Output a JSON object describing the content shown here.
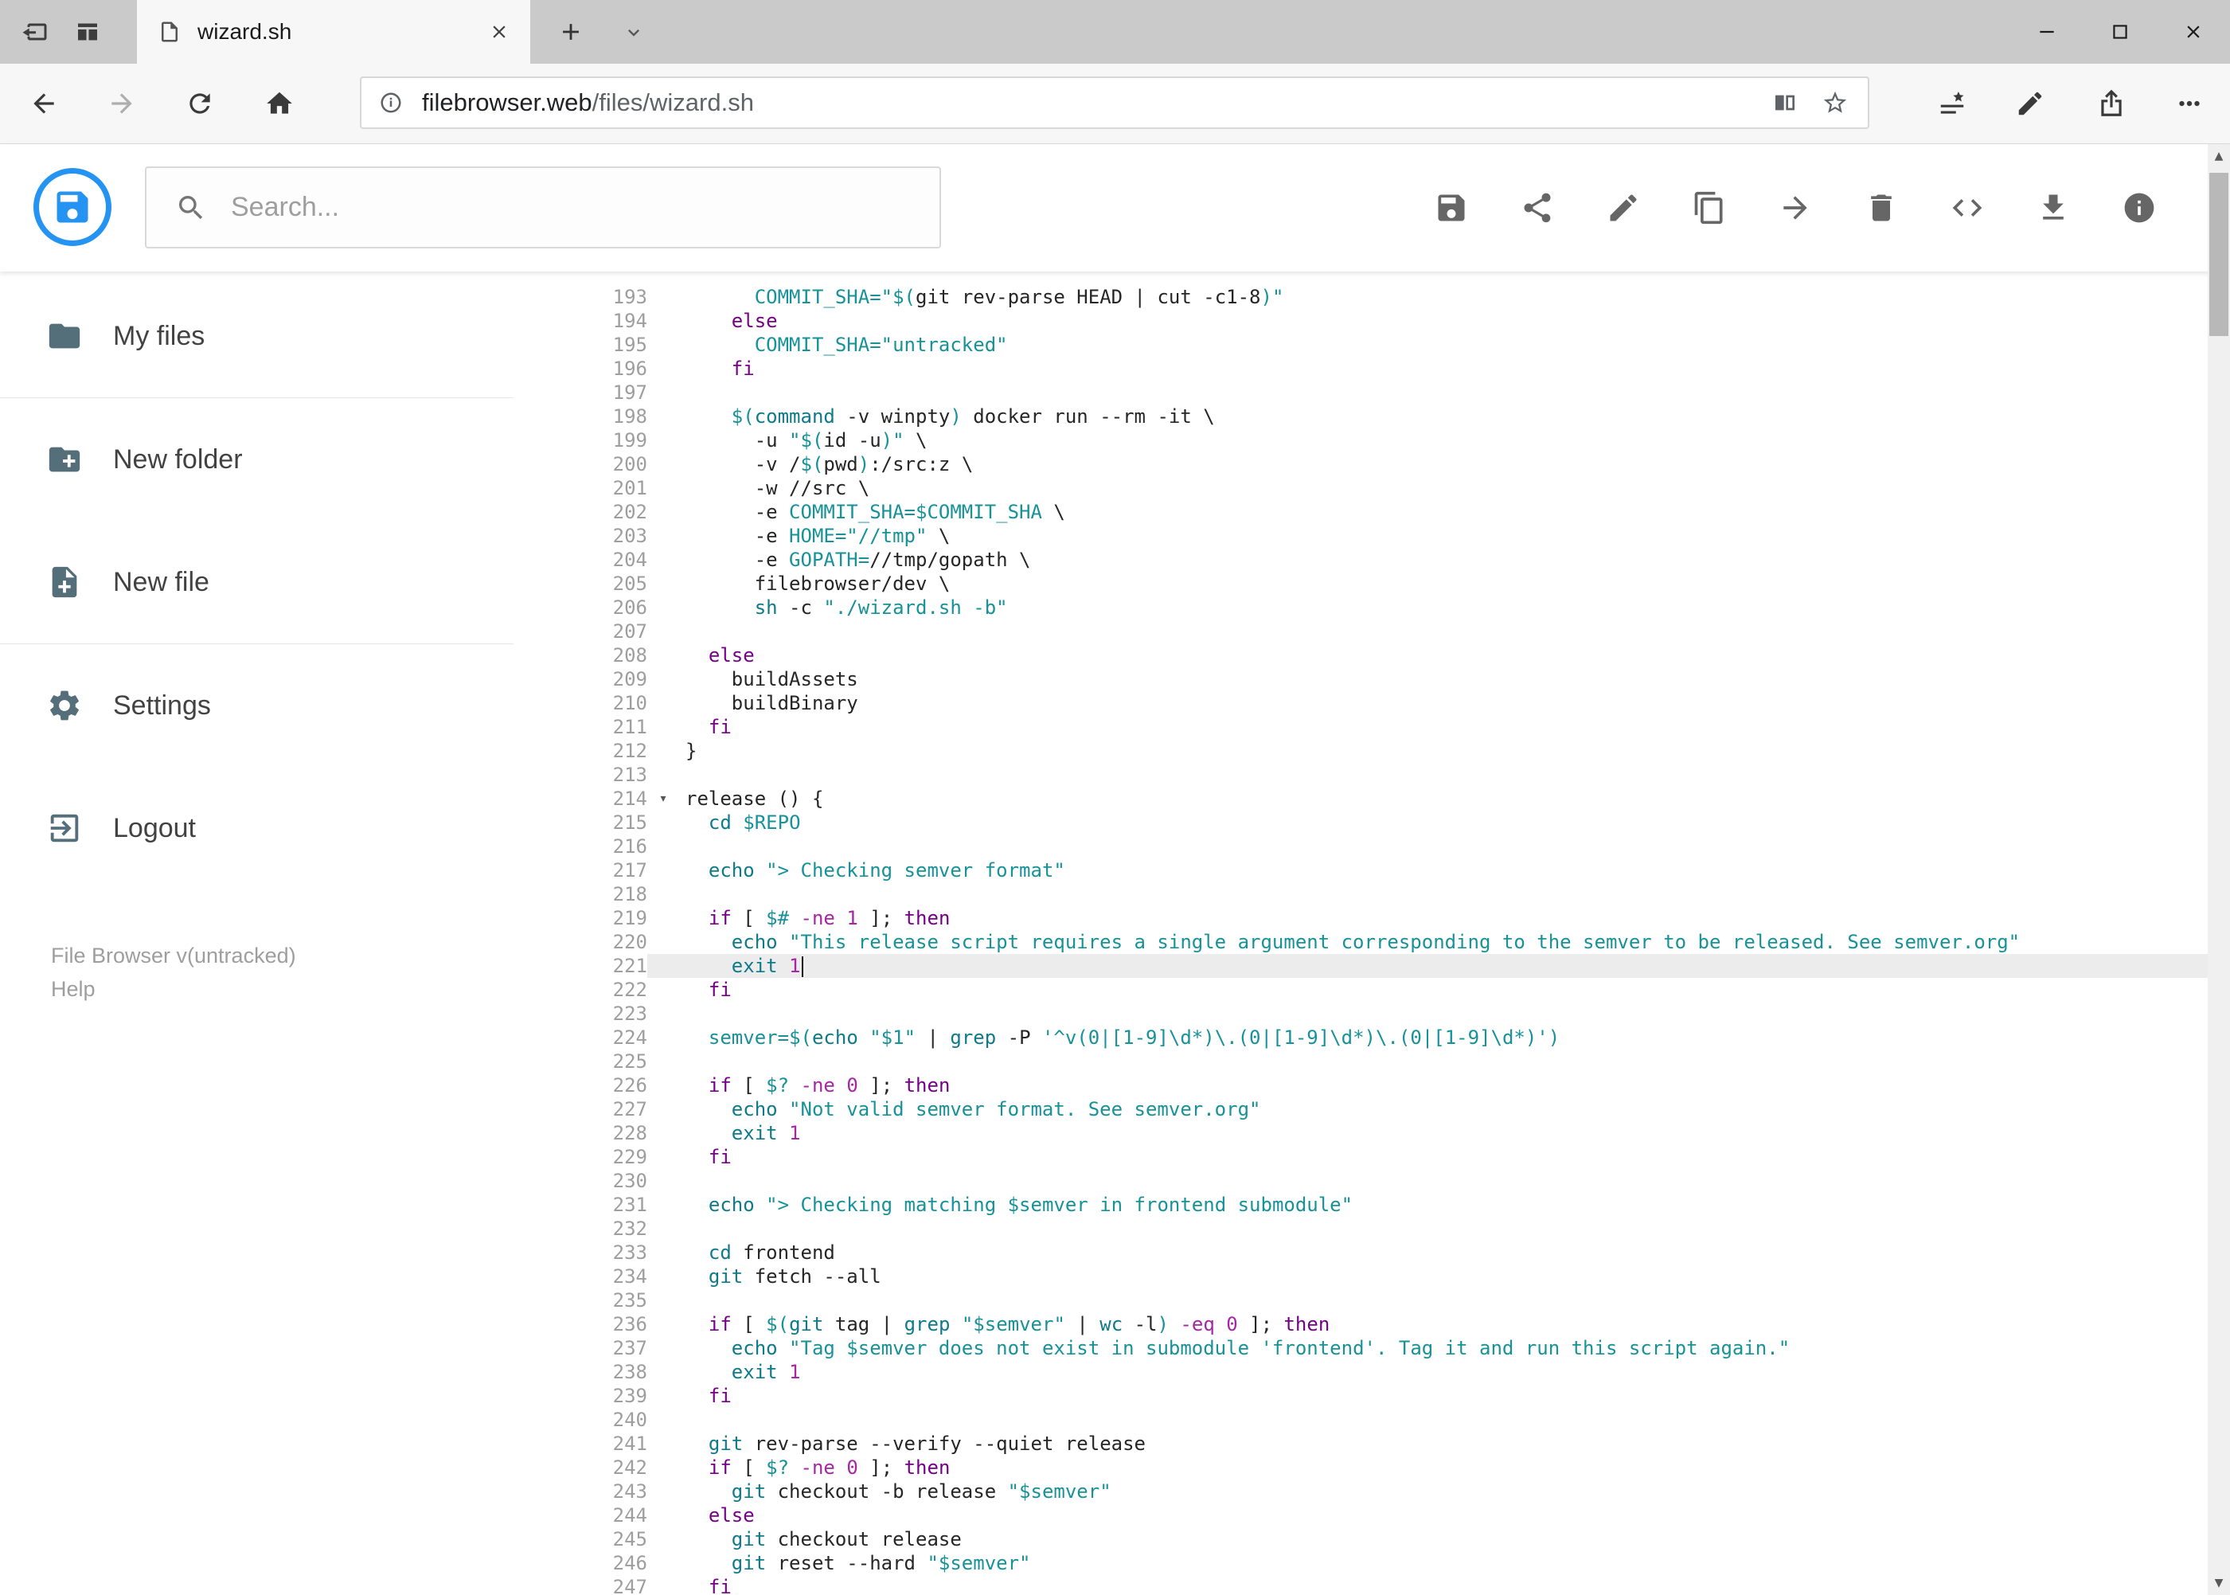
{
  "colors": {
    "accent_blue": "#2493f2",
    "active_line_highlight": "#ececec",
    "syntax_string": "#179299",
    "syntax_keyword": "#770088",
    "syntax_builtin": "#0e7a8a",
    "syntax_number": "#a626a4"
  },
  "browser": {
    "tab_title": "wizard.sh",
    "url_domain": "filebrowser.web",
    "url_path": "/files/wizard.sh"
  },
  "app": {
    "search_placeholder": "Search...",
    "actions": [
      {
        "id": "save",
        "icon": "save-icon",
        "glyph": "save"
      },
      {
        "id": "share",
        "icon": "share-icon",
        "glyph": "share"
      },
      {
        "id": "edit",
        "icon": "edit-icon",
        "glyph": "edit"
      },
      {
        "id": "copy",
        "icon": "copy-icon",
        "glyph": "copy"
      },
      {
        "id": "move",
        "icon": "move-icon",
        "glyph": "move"
      },
      {
        "id": "delete",
        "icon": "delete-icon",
        "glyph": "delete"
      },
      {
        "id": "code",
        "icon": "code-icon",
        "glyph": "code"
      },
      {
        "id": "download",
        "icon": "download-icon",
        "glyph": "download"
      },
      {
        "id": "info",
        "icon": "info-icon",
        "glyph": "info"
      }
    ],
    "sidebar": {
      "items": [
        {
          "id": "my-files",
          "label": "My files",
          "icon": "folder-icon",
          "glyph": "folder",
          "divider_after": true
        },
        {
          "id": "new-folder",
          "label": "New folder",
          "icon": "folder-plus-icon",
          "glyph": "folder-plus"
        },
        {
          "id": "new-file",
          "label": "New file",
          "icon": "file-plus-icon",
          "glyph": "file-plus",
          "divider_after": true
        },
        {
          "id": "settings",
          "label": "Settings",
          "icon": "gear-icon",
          "glyph": "gear"
        },
        {
          "id": "logout",
          "label": "Logout",
          "icon": "logout-icon",
          "glyph": "logout"
        }
      ],
      "footer_line1": "File Browser v(untracked)",
      "footer_line2": "Help"
    }
  },
  "editor": {
    "active_line": 221,
    "lines": [
      {
        "n": 193,
        "t": [
          [
            "pl",
            "      "
          ],
          [
            "defn",
            "COMMIT_SHA="
          ],
          [
            "str",
            "\"$("
          ],
          [
            "pl",
            "git rev-parse HEAD | cut -c1-8"
          ],
          [
            "str",
            ")\""
          ]
        ]
      },
      {
        "n": 194,
        "t": [
          [
            "pl",
            "    "
          ],
          [
            "kw",
            "else"
          ]
        ]
      },
      {
        "n": 195,
        "t": [
          [
            "pl",
            "      "
          ],
          [
            "defn",
            "COMMIT_SHA="
          ],
          [
            "str",
            "\"untracked\""
          ]
        ]
      },
      {
        "n": 196,
        "t": [
          [
            "pl",
            "    "
          ],
          [
            "kw",
            "fi"
          ]
        ]
      },
      {
        "n": 197,
        "t": []
      },
      {
        "n": 198,
        "t": [
          [
            "pl",
            "    "
          ],
          [
            "var",
            "$("
          ],
          [
            "bi",
            "command"
          ],
          [
            "pl",
            " -v winpty"
          ],
          [
            "var",
            ")"
          ],
          [
            "pl",
            " docker run --rm -it \\"
          ]
        ]
      },
      {
        "n": 199,
        "t": [
          [
            "pl",
            "      -u "
          ],
          [
            "str",
            "\"$("
          ],
          [
            "pl",
            "id -u"
          ],
          [
            "str",
            ")\""
          ],
          [
            "pl",
            " \\"
          ]
        ]
      },
      {
        "n": 200,
        "t": [
          [
            "pl",
            "      -v /"
          ],
          [
            "var",
            "$("
          ],
          [
            "pl",
            "pwd"
          ],
          [
            "var",
            ")"
          ],
          [
            "pl",
            ":/src:z \\"
          ]
        ]
      },
      {
        "n": 201,
        "t": [
          [
            "pl",
            "      -w //src \\"
          ]
        ]
      },
      {
        "n": 202,
        "t": [
          [
            "pl",
            "      -e "
          ],
          [
            "defn",
            "COMMIT_SHA="
          ],
          [
            "var",
            "$COMMIT_SHA"
          ],
          [
            "pl",
            " \\"
          ]
        ]
      },
      {
        "n": 203,
        "t": [
          [
            "pl",
            "      -e "
          ],
          [
            "defn",
            "HOME="
          ],
          [
            "str",
            "\"//tmp\""
          ],
          [
            "pl",
            " \\"
          ]
        ]
      },
      {
        "n": 204,
        "t": [
          [
            "pl",
            "      -e "
          ],
          [
            "defn",
            "GOPATH="
          ],
          [
            "pl",
            "//tmp/gopath \\"
          ]
        ]
      },
      {
        "n": 205,
        "t": [
          [
            "pl",
            "      filebrowser/dev \\"
          ]
        ]
      },
      {
        "n": 206,
        "t": [
          [
            "pl",
            "      "
          ],
          [
            "bi",
            "sh"
          ],
          [
            "pl",
            " -c "
          ],
          [
            "str",
            "\"./wizard.sh -b\""
          ]
        ]
      },
      {
        "n": 207,
        "t": []
      },
      {
        "n": 208,
        "t": [
          [
            "pl",
            "  "
          ],
          [
            "kw",
            "else"
          ]
        ]
      },
      {
        "n": 209,
        "t": [
          [
            "pl",
            "    buildAssets"
          ]
        ]
      },
      {
        "n": 210,
        "t": [
          [
            "pl",
            "    buildBinary"
          ]
        ]
      },
      {
        "n": 211,
        "t": [
          [
            "pl",
            "  "
          ],
          [
            "kw",
            "fi"
          ]
        ]
      },
      {
        "n": 212,
        "t": [
          [
            "pl",
            "}"
          ]
        ]
      },
      {
        "n": 213,
        "t": []
      },
      {
        "n": 214,
        "fold": true,
        "t": [
          [
            "pl",
            "release () {"
          ]
        ]
      },
      {
        "n": 215,
        "t": [
          [
            "pl",
            "  "
          ],
          [
            "bi",
            "cd"
          ],
          [
            "pl",
            " "
          ],
          [
            "var",
            "$REPO"
          ]
        ]
      },
      {
        "n": 216,
        "t": []
      },
      {
        "n": 217,
        "t": [
          [
            "pl",
            "  "
          ],
          [
            "bi",
            "echo"
          ],
          [
            "pl",
            " "
          ],
          [
            "str",
            "\"> Checking semver format\""
          ]
        ]
      },
      {
        "n": 218,
        "t": []
      },
      {
        "n": 219,
        "t": [
          [
            "pl",
            "  "
          ],
          [
            "kw",
            "if"
          ],
          [
            "pl",
            " [ "
          ],
          [
            "var",
            "$#"
          ],
          [
            "pl",
            " "
          ],
          [
            "op",
            "-ne"
          ],
          [
            "pl",
            " "
          ],
          [
            "num",
            "1"
          ],
          [
            "pl",
            " ]; "
          ],
          [
            "kw",
            "then"
          ]
        ]
      },
      {
        "n": 220,
        "t": [
          [
            "pl",
            "    "
          ],
          [
            "bi",
            "echo"
          ],
          [
            "pl",
            " "
          ],
          [
            "str",
            "\"This release script requires a single argument corresponding to the semver to be released. See semver.org\""
          ]
        ]
      },
      {
        "n": 221,
        "active": true,
        "cursor": true,
        "t": [
          [
            "pl",
            "    "
          ],
          [
            "bi",
            "exit"
          ],
          [
            "pl",
            " "
          ],
          [
            "num",
            "1"
          ]
        ]
      },
      {
        "n": 222,
        "t": [
          [
            "pl",
            "  "
          ],
          [
            "kw",
            "fi"
          ]
        ]
      },
      {
        "n": 223,
        "t": []
      },
      {
        "n": 224,
        "t": [
          [
            "pl",
            "  "
          ],
          [
            "defn",
            "semver="
          ],
          [
            "var",
            "$("
          ],
          [
            "bi",
            "echo"
          ],
          [
            "pl",
            " "
          ],
          [
            "str",
            "\"$1\""
          ],
          [
            "pl",
            " | "
          ],
          [
            "bi",
            "grep"
          ],
          [
            "pl",
            " -P "
          ],
          [
            "str",
            "'^v(0|[1-9]\\d*)\\.(0|[1-9]\\d*)\\.(0|[1-9]\\d*)'"
          ],
          [
            "var",
            ")"
          ]
        ]
      },
      {
        "n": 225,
        "t": []
      },
      {
        "n": 226,
        "t": [
          [
            "pl",
            "  "
          ],
          [
            "kw",
            "if"
          ],
          [
            "pl",
            " [ "
          ],
          [
            "var",
            "$?"
          ],
          [
            "pl",
            " "
          ],
          [
            "op",
            "-ne"
          ],
          [
            "pl",
            " "
          ],
          [
            "num",
            "0"
          ],
          [
            "pl",
            " ]; "
          ],
          [
            "kw",
            "then"
          ]
        ]
      },
      {
        "n": 227,
        "t": [
          [
            "pl",
            "    "
          ],
          [
            "bi",
            "echo"
          ],
          [
            "pl",
            " "
          ],
          [
            "str",
            "\"Not valid semver format. See semver.org\""
          ]
        ]
      },
      {
        "n": 228,
        "t": [
          [
            "pl",
            "    "
          ],
          [
            "bi",
            "exit"
          ],
          [
            "pl",
            " "
          ],
          [
            "num",
            "1"
          ]
        ]
      },
      {
        "n": 229,
        "t": [
          [
            "pl",
            "  "
          ],
          [
            "kw",
            "fi"
          ]
        ]
      },
      {
        "n": 230,
        "t": []
      },
      {
        "n": 231,
        "t": [
          [
            "pl",
            "  "
          ],
          [
            "bi",
            "echo"
          ],
          [
            "pl",
            " "
          ],
          [
            "str",
            "\"> Checking matching "
          ],
          [
            "var",
            "$semver"
          ],
          [
            "str",
            " in frontend submodule\""
          ]
        ]
      },
      {
        "n": 232,
        "t": []
      },
      {
        "n": 233,
        "t": [
          [
            "pl",
            "  "
          ],
          [
            "bi",
            "cd"
          ],
          [
            "pl",
            " frontend"
          ]
        ]
      },
      {
        "n": 234,
        "t": [
          [
            "pl",
            "  "
          ],
          [
            "bi",
            "git"
          ],
          [
            "pl",
            " fetch --all"
          ]
        ]
      },
      {
        "n": 235,
        "t": []
      },
      {
        "n": 236,
        "t": [
          [
            "pl",
            "  "
          ],
          [
            "kw",
            "if"
          ],
          [
            "pl",
            " [ "
          ],
          [
            "var",
            "$("
          ],
          [
            "bi",
            "git"
          ],
          [
            "pl",
            " tag | "
          ],
          [
            "bi",
            "grep"
          ],
          [
            "pl",
            " "
          ],
          [
            "str",
            "\"$semver\""
          ],
          [
            "pl",
            " | "
          ],
          [
            "bi",
            "wc"
          ],
          [
            "pl",
            " -l"
          ],
          [
            "var",
            ")"
          ],
          [
            "pl",
            " "
          ],
          [
            "op",
            "-eq"
          ],
          [
            "pl",
            " "
          ],
          [
            "num",
            "0"
          ],
          [
            "pl",
            " ]; "
          ],
          [
            "kw",
            "then"
          ]
        ]
      },
      {
        "n": 237,
        "t": [
          [
            "pl",
            "    "
          ],
          [
            "bi",
            "echo"
          ],
          [
            "pl",
            " "
          ],
          [
            "str",
            "\"Tag "
          ],
          [
            "var",
            "$semver"
          ],
          [
            "str",
            " does not exist in submodule 'frontend'. Tag it and run this script again.\""
          ]
        ]
      },
      {
        "n": 238,
        "t": [
          [
            "pl",
            "    "
          ],
          [
            "bi",
            "exit"
          ],
          [
            "pl",
            " "
          ],
          [
            "num",
            "1"
          ]
        ]
      },
      {
        "n": 239,
        "t": [
          [
            "pl",
            "  "
          ],
          [
            "kw",
            "fi"
          ]
        ]
      },
      {
        "n": 240,
        "t": []
      },
      {
        "n": 241,
        "t": [
          [
            "pl",
            "  "
          ],
          [
            "bi",
            "git"
          ],
          [
            "pl",
            " rev-parse --verify --quiet release"
          ]
        ]
      },
      {
        "n": 242,
        "t": [
          [
            "pl",
            "  "
          ],
          [
            "kw",
            "if"
          ],
          [
            "pl",
            " [ "
          ],
          [
            "var",
            "$?"
          ],
          [
            "pl",
            " "
          ],
          [
            "op",
            "-ne"
          ],
          [
            "pl",
            " "
          ],
          [
            "num",
            "0"
          ],
          [
            "pl",
            " ]; "
          ],
          [
            "kw",
            "then"
          ]
        ]
      },
      {
        "n": 243,
        "t": [
          [
            "pl",
            "    "
          ],
          [
            "bi",
            "git"
          ],
          [
            "pl",
            " checkout -b release "
          ],
          [
            "str",
            "\"$semver\""
          ]
        ]
      },
      {
        "n": 244,
        "t": [
          [
            "pl",
            "  "
          ],
          [
            "kw",
            "else"
          ]
        ]
      },
      {
        "n": 245,
        "t": [
          [
            "pl",
            "    "
          ],
          [
            "bi",
            "git"
          ],
          [
            "pl",
            " checkout release"
          ]
        ]
      },
      {
        "n": 246,
        "t": [
          [
            "pl",
            "    "
          ],
          [
            "bi",
            "git"
          ],
          [
            "pl",
            " reset --hard "
          ],
          [
            "str",
            "\"$semver\""
          ]
        ]
      },
      {
        "n": 247,
        "t": [
          [
            "pl",
            "  "
          ],
          [
            "kw",
            "fi"
          ]
        ]
      }
    ]
  }
}
